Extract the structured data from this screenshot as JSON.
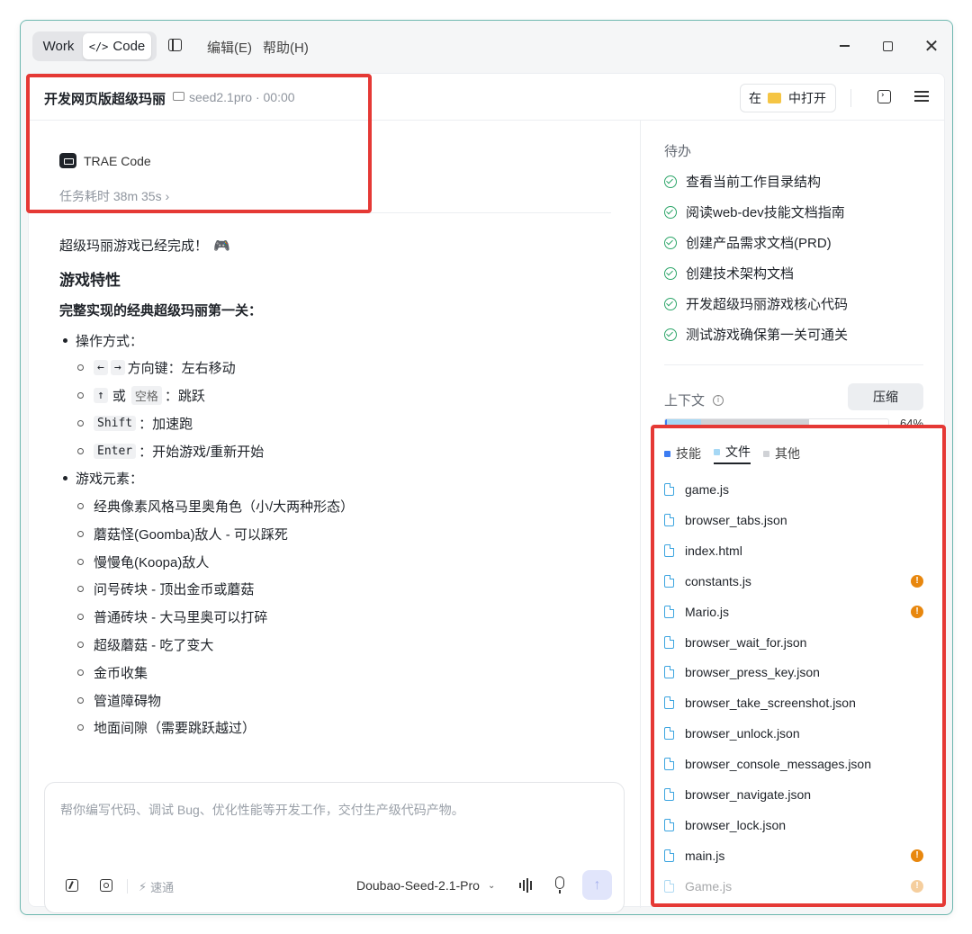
{
  "titlebar": {
    "mode_work": "Work",
    "mode_code": "Code",
    "code_glyph": "</>",
    "menu_edit": "编辑(E)",
    "menu_help": "帮助(H)",
    "close_glyph": "✕"
  },
  "header": {
    "title": "开发网页版超级玛丽",
    "meta": "seed2.1pro · 00:00",
    "open_in_prefix": "在",
    "open_in_suffix": "中打开"
  },
  "chat": {
    "agent_name": "TRAE Code",
    "duration": "任务耗时 38m 35s ›",
    "done_message": "超级玛丽游戏已经完成！",
    "done_emoji": "🎮",
    "heading": "游戏特性",
    "subheading": "完整实现的经典超级玛丽第一关：",
    "controls_label": "操作方式：",
    "controls": {
      "arrow_left": "←",
      "arrow_right": "→",
      "arrow_text": "方向键：左右移动",
      "up_key": "↑",
      "or": "或",
      "space_key": "空格",
      "jump_text": "：跳跃",
      "shift_key": "Shift",
      "shift_text": "：加速跑",
      "enter_key": "Enter",
      "enter_text": "：开始游戏/重新开始"
    },
    "elements_label": "游戏元素：",
    "elements": [
      "经典像素风格马里奥角色（小/大两种形态）",
      "蘑菇怪(Goomba)敌人 - 可以踩死",
      "慢慢龟(Koopa)敌人",
      "问号砖块 - 顶出金币或蘑菇",
      "普通砖块 - 大马里奥可以打碎",
      "超级蘑菇 - 吃了变大",
      "金币收集",
      "管道障碍物",
      "地面间隙（需要跳跃越过）"
    ]
  },
  "input": {
    "placeholder": "帮你编写代码、调试 Bug、优化性能等开发工作，交付生产级代码产物。",
    "speed_label": "速通",
    "speed_icon": "⚡",
    "model": "Doubao-Seed-2.1-Pro",
    "chevron": "⌄",
    "send_icon": "↑"
  },
  "todo": {
    "title": "待办",
    "items": [
      "查看当前工作目录结构",
      "阅读web-dev技能文档指南",
      "创建产品需求文档(PRD)",
      "创建技术架构文档",
      "开发超级玛丽游戏核心代码",
      "测试游戏确保第一关可通关"
    ]
  },
  "context": {
    "title": "上下文",
    "info_icon": "i",
    "compress": "压缩",
    "percent": "64%",
    "usage_fraction": 0.64,
    "tabs": [
      "技能",
      "文件",
      "其他"
    ],
    "active_tab": "文件",
    "colors": {
      "skill": "#3c7cf2",
      "file": "#a6d8f5",
      "other": "#d0d2d6",
      "warning": "#e8870e"
    },
    "files": [
      {
        "name": "game.js",
        "warning": false
      },
      {
        "name": "browser_tabs.json",
        "warning": false
      },
      {
        "name": "index.html",
        "warning": false
      },
      {
        "name": "constants.js",
        "warning": true
      },
      {
        "name": "Mario.js",
        "warning": true
      },
      {
        "name": "browser_wait_for.json",
        "warning": false
      },
      {
        "name": "browser_press_key.json",
        "warning": false
      },
      {
        "name": "browser_take_screenshot.json",
        "warning": false
      },
      {
        "name": "browser_unlock.json",
        "warning": false
      },
      {
        "name": "browser_console_messages.json",
        "warning": false
      },
      {
        "name": "browser_navigate.json",
        "warning": false
      },
      {
        "name": "browser_lock.json",
        "warning": false
      },
      {
        "name": "main.js",
        "warning": true
      },
      {
        "name": "Game.js",
        "warning": true
      }
    ],
    "warning_glyph": "!"
  }
}
